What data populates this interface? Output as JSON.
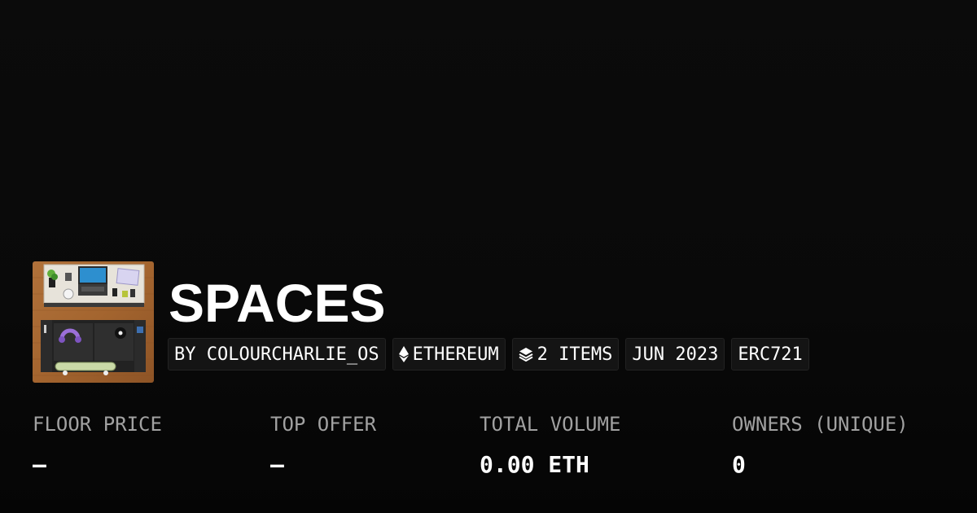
{
  "collection": {
    "title": "SPACES"
  },
  "tags": {
    "creator": "BY COLOURCHARLIE_OS",
    "chain": "ETHEREUM",
    "items": "2 ITEMS",
    "date": "JUN 2023",
    "standard": "ERC721"
  },
  "icons": {
    "chain": "ethereum-icon",
    "items": "layers-icon"
  },
  "stats": [
    {
      "label": "FLOOR PRICE",
      "value": "–"
    },
    {
      "label": "TOP OFFER",
      "value": "–"
    },
    {
      "label": "TOTAL VOLUME",
      "value": "0.00 ETH"
    },
    {
      "label": "OWNERS (UNIQUE)",
      "value": "0"
    }
  ],
  "colors": {
    "background": "#0b0b0b",
    "tag_background": "#141414",
    "label_gray": "#a1a1a1",
    "text": "#ffffff"
  }
}
